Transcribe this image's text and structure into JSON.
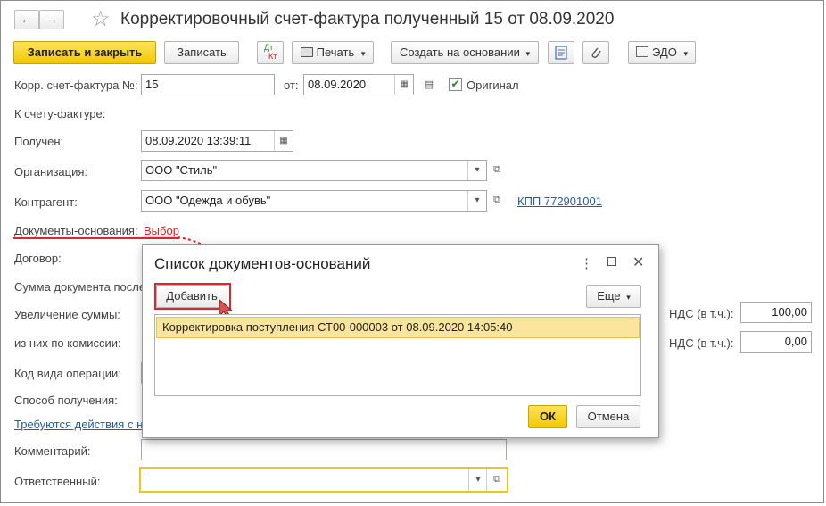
{
  "window": {
    "title": "Корректировочный счет-фактура полученный 15 от 08.09.2020",
    "back_icon": "←",
    "forward_icon": "→",
    "star_icon": "☆"
  },
  "toolbar": {
    "save_close": "Записать и закрыть",
    "save": "Записать",
    "dtkt_top": "Дт",
    "dtkt_bottom": "Кт",
    "print": "Печать",
    "create_based": "Создать на основании",
    "edo": "ЭДО",
    "dropdown_arrow": "▾"
  },
  "form": {
    "corr_invoice_label": "Корр. счет-фактура №:",
    "corr_invoice_number": "15",
    "from_label": "от:",
    "from_date": "08.09.2020",
    "original_label": "Оригинал",
    "original_checked": "✔",
    "to_invoice_label": "К счету-фактуре:",
    "received_label": "Получен:",
    "received_value": "08.09.2020 13:39:11",
    "organization_label": "Организация:",
    "organization_value": "ООО \"Стиль\"",
    "counterparty_label": "Контрагент:",
    "counterparty_value": "ООО \"Одежда и обувь\"",
    "kpp_link": "КПП 772901001",
    "base_docs_label": "Документы-основания:",
    "base_docs_link": "Выбор",
    "contract_label": "Договор:",
    "doc_sum_label": "Сумма документа после",
    "increase_label": "Увеличение суммы:",
    "commission_label": "из них по комиссии:",
    "op_code_label": "Код вида операции:",
    "receipt_method_label": "Способ получения:",
    "actions_link": "Требуются действия с н",
    "vat_label_1": "НДС (в т.ч.):",
    "vat_value_1": "100,00",
    "vat_label_2": "НДС (в т.ч.):",
    "vat_value_2": "0,00",
    "comment_label": "Комментарий:",
    "comment_value": "",
    "responsible_label": "Ответственный:",
    "responsible_value": ""
  },
  "modal": {
    "title": "Список документов-оснований",
    "add_button": "Добавить",
    "more_button": "Еще",
    "rows": [
      "Корректировка поступления СТ00-000003 от 08.09.2020 14:05:40"
    ],
    "ok_button": "ОК",
    "cancel_button": "Отмена",
    "menu_icon": "⋮",
    "maximize_icon": "□",
    "close_icon": "✕"
  }
}
